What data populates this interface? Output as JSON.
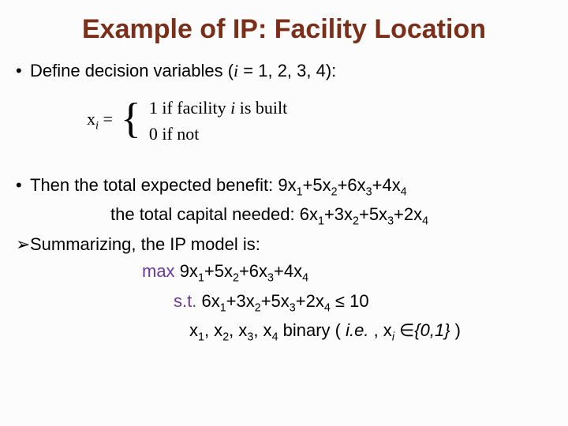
{
  "title": "Example of IP: Facility Location",
  "b1_pre": "Define decision variables (",
  "b1_i": "i",
  "b1_post": " = 1, 2, 3, 4):",
  "eq_lhs": "x",
  "eq_sub": "i",
  "eq_eq": " = ",
  "case1_a": "1   if facility ",
  "case1_i": "i",
  "case1_b": " is built",
  "case2": "0   if not",
  "b2_a": "Then the total expected benefit:  9x",
  "b2_b": "+5x",
  "b2_c": "+6x",
  "b2_d": "+4x",
  "l3_a": "the total capital needed:  6x",
  "l3_b": "+3x",
  "l3_c": "+5x",
  "l3_d": "+2x",
  "b4": "Summarizing, the IP model is:",
  "l5_a": "max ",
  "l5_b": "9x",
  "l5_c": "+5x",
  "l5_d": "+6x",
  "l5_e": "+4x",
  "l6_a": "s.t. ",
  "l6_b": "6x",
  "l6_c": "+3x",
  "l6_d": "+5x",
  "l6_e": "+2x",
  "l6_f": " ≤ 10",
  "l7_a": "x",
  "l7_b": ", x",
  "l7_c": " binary  ( ",
  "l7_d": "i.e.",
  "l7_e": " , x",
  "l7_f": " ∈",
  "l7_g": "{0,1}",
  "l7_h": " )",
  "s1": "1",
  "s2": "2",
  "s3": "3",
  "s4": "4",
  "si": "i",
  "dot": "•",
  "tri": "➢"
}
